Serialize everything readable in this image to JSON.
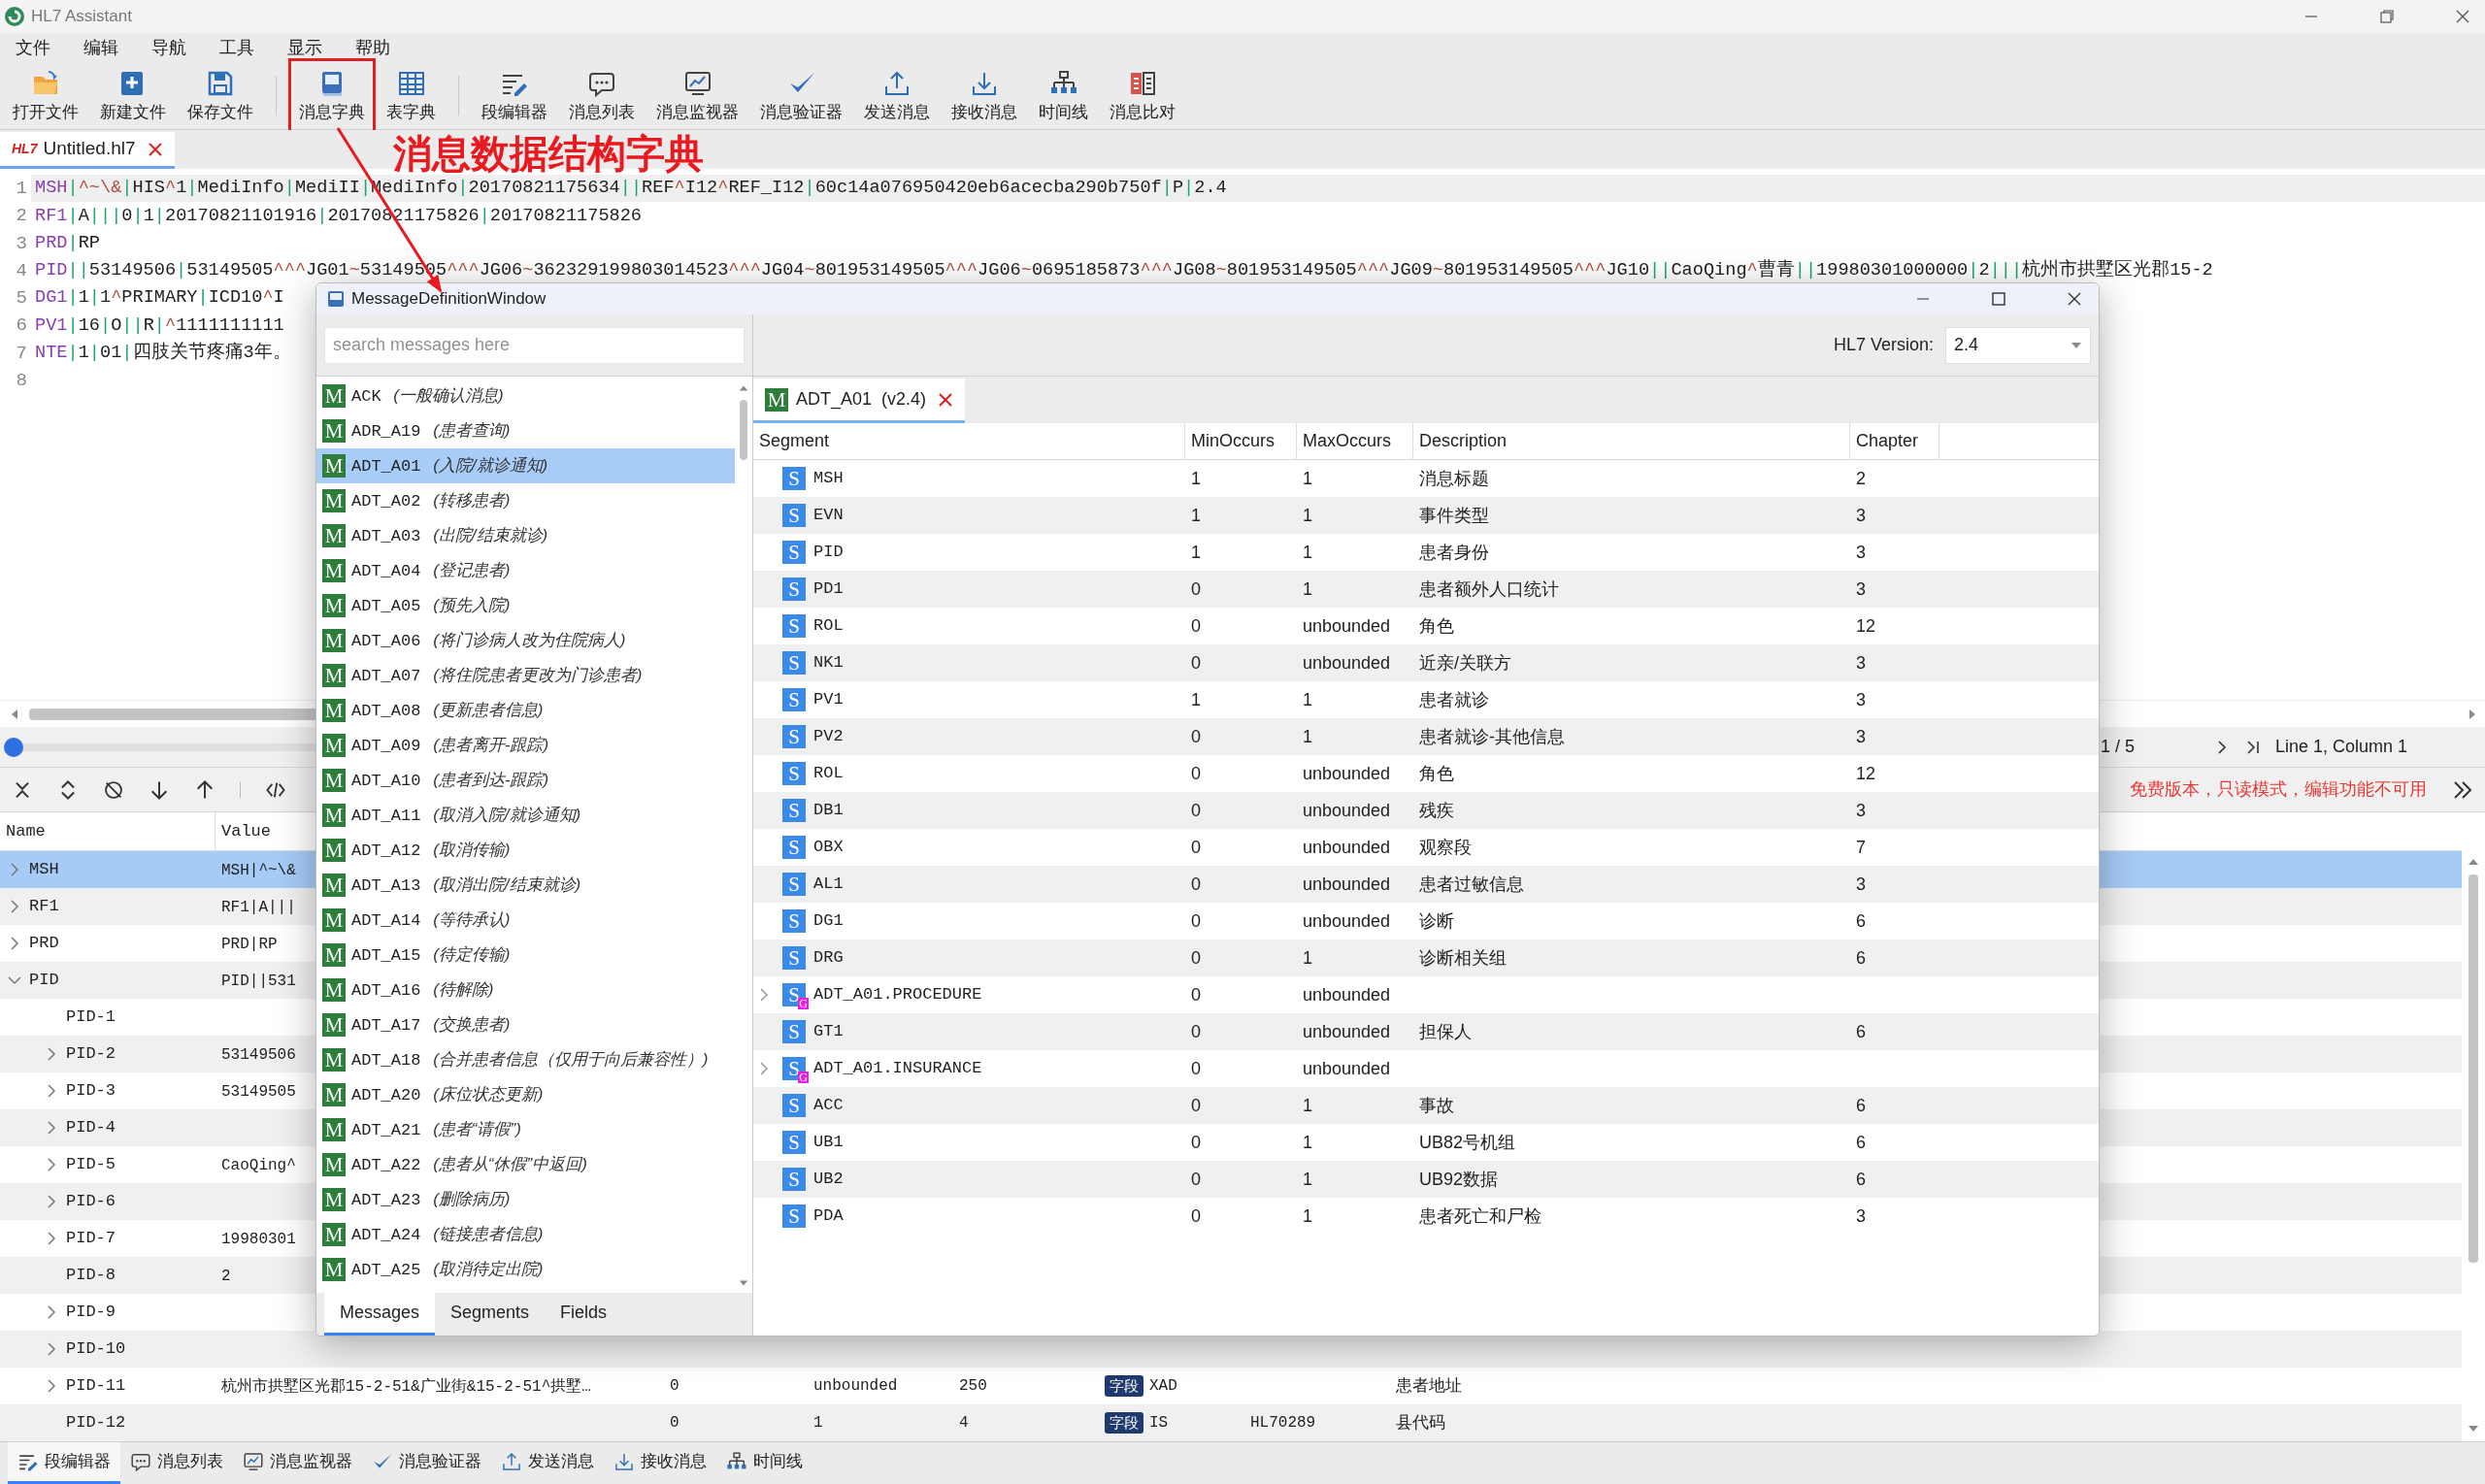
{
  "window": {
    "title": "HL7 Assistant"
  },
  "menu": [
    "文件",
    "编辑",
    "导航",
    "工具",
    "显示",
    "帮助"
  ],
  "toolbar_groups": [
    [
      {
        "label": "打开文件",
        "kind": "open",
        "highlighted": false
      },
      {
        "label": "新建文件",
        "kind": "new",
        "highlighted": false
      },
      {
        "label": "保存文件",
        "kind": "save",
        "highlighted": false
      }
    ],
    [
      {
        "label": "消息字典",
        "kind": "dict",
        "highlighted": true
      },
      {
        "label": "表字典",
        "kind": "table",
        "highlighted": false
      }
    ],
    [
      {
        "label": "段编辑器",
        "kind": "edit",
        "highlighted": false
      },
      {
        "label": "消息列表",
        "kind": "list",
        "highlighted": false
      },
      {
        "label": "消息监视器",
        "kind": "monitor",
        "highlighted": false
      },
      {
        "label": "消息验证器",
        "kind": "validate",
        "highlighted": false
      },
      {
        "label": "发送消息",
        "kind": "send",
        "highlighted": false
      },
      {
        "label": "接收消息",
        "kind": "receive",
        "highlighted": false
      },
      {
        "label": "时间线",
        "kind": "timeline",
        "highlighted": false
      },
      {
        "label": "消息比对",
        "kind": "compare",
        "highlighted": false
      }
    ]
  ],
  "annotation": {
    "text": "消息数据结构字典"
  },
  "file_tab": {
    "badge": "HL7",
    "label": "Untitled.hl7",
    "selected": true
  },
  "editor": {
    "lines": [
      {
        "number": "1",
        "text": "MSH|^~\\&|HIS^1|MediInfo|MediII|MediInfo|20170821175634||REF^I12^REF_I12|60c14a076950420eb6acecba290b750f|P|2.4",
        "current": true
      },
      {
        "number": "2",
        "text": "RF1|A|||0|1|20170821101916|20170821175826|20170821175826",
        "current": false
      },
      {
        "number": "3",
        "text": "PRD|RP",
        "current": false
      },
      {
        "number": "4",
        "text": "PID||53149506|53149505^^^JG01~53149505^^^JG06~362329199803014523^^^JG04~801953149505^^^JG06~0695185873^^^JG08~801953149505^^^JG09~801953149505^^^JG10||CaoQing^曹青||19980301000000|2|||杭州市拱墅区光郡15-2",
        "current": false
      },
      {
        "number": "5",
        "text": "DG1|1|1^PRIMARY|ICD10^I",
        "current": false
      },
      {
        "number": "6",
        "text": "PV1|16|O||R|^1111111111",
        "current": false
      },
      {
        "number": "7",
        "text": "NTE|1|01|四肢关节疼痛3年。",
        "current": false
      },
      {
        "number": "8",
        "current": false
      }
    ]
  },
  "navigator": {
    "slider": {
      "level": 0
    },
    "position": "1 / 5",
    "cursor": "Line 1, Column 1"
  },
  "notice": "免费版本，只读模式，编辑功能不可用",
  "tree": {
    "columns": [
      "Name",
      "Value"
    ],
    "rows": [
      {
        "name": "MSH",
        "value": "MSH|^~\\&",
        "expanded": false,
        "selected": true
      },
      {
        "name": "RF1",
        "value": "RF1|A|||",
        "expanded": false,
        "selected": false
      },
      {
        "name": "PRD",
        "value": "PRD|RP",
        "expanded": false,
        "selected": false
      },
      {
        "name": "PID",
        "value": "PID||531",
        "expanded": true,
        "selected": false,
        "children": [
          {
            "name": "PID-1",
            "selected": false
          },
          {
            "name": "PID-2",
            "value": "53149506",
            "expanded": false,
            "selected": false
          },
          {
            "name": "PID-3",
            "value": "53149505",
            "expanded": false,
            "selected": false
          },
          {
            "name": "PID-4",
            "expanded": false,
            "selected": false
          },
          {
            "name": "PID-5",
            "value": "CaoQing^",
            "expanded": false,
            "selected": false
          },
          {
            "name": "PID-6",
            "expanded": false,
            "selected": false
          },
          {
            "name": "PID-7",
            "value": "19980301",
            "expanded": false,
            "selected": false
          },
          {
            "name": "PID-8",
            "value": "2",
            "selected": false
          },
          {
            "name": "PID-9",
            "expanded": false,
            "selected": false
          },
          {
            "name": "PID-10",
            "expanded": false,
            "selected": false
          },
          {
            "name": "PID-11",
            "value": "杭州市拱墅区光郡15-2-51&广业街&15-2-51^拱墅…",
            "expanded": false,
            "selected": false,
            "cells": {
              "min": "0",
              "max": "unbounded",
              "length": "250",
              "badge": "字段",
              "type": "XAD",
              "description": "患者地址"
            }
          },
          {
            "name": "PID-12",
            "selected": false,
            "cells": {
              "min": "0",
              "max": "1",
              "length": "4",
              "badge": "字段",
              "type": "IS",
              "table": "HL70289",
              "description": "县代码"
            }
          }
        ]
      }
    ]
  },
  "bottom_tabs": [
    {
      "label": "段编辑器",
      "kind": "edit",
      "selected": true
    },
    {
      "label": "消息列表",
      "kind": "list",
      "selected": false
    },
    {
      "label": "消息监视器",
      "kind": "monitor",
      "selected": false
    },
    {
      "label": "消息验证器",
      "kind": "validate",
      "selected": false
    },
    {
      "label": "发送消息",
      "kind": "send",
      "selected": false
    },
    {
      "label": "接收消息",
      "kind": "receive",
      "selected": false
    },
    {
      "label": "时间线",
      "kind": "timeline",
      "selected": false
    }
  ],
  "dialog": {
    "title": "MessageDefinitionWindow",
    "search": {
      "placeholder": "search messages here"
    },
    "messages": [
      {
        "icon": "M",
        "code": "ACK",
        "description": "(一般确认消息)",
        "selected": false
      },
      {
        "icon": "M",
        "code": "ADR_A19",
        "description": "(患者查询)",
        "selected": false
      },
      {
        "icon": "M",
        "code": "ADT_A01",
        "description": "(入院/就诊通知)",
        "selected": true
      },
      {
        "icon": "M",
        "code": "ADT_A02",
        "description": "(转移患者)",
        "selected": false
      },
      {
        "icon": "M",
        "code": "ADT_A03",
        "description": "(出院/结束就诊)",
        "selected": false
      },
      {
        "icon": "M",
        "code": "ADT_A04",
        "description": "(登记患者)",
        "selected": false
      },
      {
        "icon": "M",
        "code": "ADT_A05",
        "description": "(预先入院)",
        "selected": false
      },
      {
        "icon": "M",
        "code": "ADT_A06",
        "description": "(将门诊病人改为住院病人)",
        "selected": false
      },
      {
        "icon": "M",
        "code": "ADT_A07",
        "description": "(将住院患者更改为门诊患者)",
        "selected": false
      },
      {
        "icon": "M",
        "code": "ADT_A08",
        "description": "(更新患者信息)",
        "selected": false
      },
      {
        "icon": "M",
        "code": "ADT_A09",
        "description": "(患者离开-跟踪)",
        "selected": false
      },
      {
        "icon": "M",
        "code": "ADT_A10",
        "description": "(患者到达-跟踪)",
        "selected": false
      },
      {
        "icon": "M",
        "code": "ADT_A11",
        "description": "(取消入院/就诊通知)",
        "selected": false
      },
      {
        "icon": "M",
        "code": "ADT_A12",
        "description": "(取消传输)",
        "selected": false
      },
      {
        "icon": "M",
        "code": "ADT_A13",
        "description": "(取消出院/结束就诊)",
        "selected": false
      },
      {
        "icon": "M",
        "code": "ADT_A14",
        "description": "(等待承认)",
        "selected": false
      },
      {
        "icon": "M",
        "code": "ADT_A15",
        "description": "(待定传输)",
        "selected": false
      },
      {
        "icon": "M",
        "code": "ADT_A16",
        "description": "(待解除)",
        "selected": false
      },
      {
        "icon": "M",
        "code": "ADT_A17",
        "description": "(交换患者)",
        "selected": false
      },
      {
        "icon": "M",
        "code": "ADT_A18",
        "description": "(合并患者信息（仅用于向后兼容性）)",
        "selected": false
      },
      {
        "icon": "M",
        "code": "ADT_A20",
        "description": "(床位状态更新)",
        "selected": false
      },
      {
        "icon": "M",
        "code": "ADT_A21",
        "description": "(患者“请假”)",
        "selected": false
      },
      {
        "icon": "M",
        "code": "ADT_A22",
        "description": "(患者从“休假”中返回)",
        "selected": false
      },
      {
        "icon": "M",
        "code": "ADT_A23",
        "description": "(删除病历)",
        "selected": false
      },
      {
        "icon": "M",
        "code": "ADT_A24",
        "description": "(链接患者信息)",
        "selected": false
      },
      {
        "icon": "M",
        "code": "ADT_A25",
        "description": "(取消待定出院)",
        "selected": false
      }
    ],
    "pane_tabs": [
      {
        "label": "Messages",
        "selected": true
      },
      {
        "label": "Segments",
        "selected": false
      },
      {
        "label": "Fields",
        "selected": false
      }
    ],
    "version_label": "HL7 Version:",
    "version": "2.4",
    "doc_tab": {
      "icon": "M",
      "label": "ADT_A01  (v2.4)",
      "selected": true
    },
    "columns": [
      "Segment",
      "MinOccurs",
      "MaxOccurs",
      "Description",
      "Chapter"
    ],
    "rows": [
      {
        "kind": "segment",
        "icon": "S",
        "segment": "MSH",
        "min": "1",
        "max": "1",
        "description": "消息标题",
        "chapter": "2"
      },
      {
        "kind": "segment",
        "icon": "S",
        "segment": "EVN",
        "min": "1",
        "max": "1",
        "description": "事件类型",
        "chapter": "3"
      },
      {
        "kind": "segment",
        "icon": "S",
        "segment": "PID",
        "min": "1",
        "max": "1",
        "description": "患者身份",
        "chapter": "3"
      },
      {
        "kind": "segment",
        "icon": "S",
        "segment": "PD1",
        "min": "0",
        "max": "1",
        "description": "患者额外人口统计",
        "chapter": "3"
      },
      {
        "kind": "segment",
        "icon": "S",
        "segment": "ROL",
        "min": "0",
        "max": "unbounded",
        "description": "角色",
        "chapter": "12"
      },
      {
        "kind": "segment",
        "icon": "S",
        "segment": "NK1",
        "min": "0",
        "max": "unbounded",
        "description": "近亲/关联方",
        "chapter": "3"
      },
      {
        "kind": "segment",
        "icon": "S",
        "segment": "PV1",
        "min": "1",
        "max": "1",
        "description": "患者就诊",
        "chapter": "3"
      },
      {
        "kind": "segment",
        "icon": "S",
        "segment": "PV2",
        "min": "0",
        "max": "1",
        "description": "患者就诊-其他信息",
        "chapter": "3"
      },
      {
        "kind": "segment",
        "icon": "S",
        "segment": "ROL",
        "min": "0",
        "max": "unbounded",
        "description": "角色",
        "chapter": "12"
      },
      {
        "kind": "segment",
        "icon": "S",
        "segment": "DB1",
        "min": "0",
        "max": "unbounded",
        "description": "残疾",
        "chapter": "3"
      },
      {
        "kind": "segment",
        "icon": "S",
        "segment": "OBX",
        "min": "0",
        "max": "unbounded",
        "description": "观察段",
        "chapter": "7"
      },
      {
        "kind": "segment",
        "icon": "S",
        "segment": "AL1",
        "min": "0",
        "max": "unbounded",
        "description": "患者过敏信息",
        "chapter": "3"
      },
      {
        "kind": "segment",
        "icon": "S",
        "segment": "DG1",
        "min": "0",
        "max": "unbounded",
        "description": "诊断",
        "chapter": "6"
      },
      {
        "kind": "segment",
        "icon": "S",
        "segment": "DRG",
        "min": "0",
        "max": "1",
        "description": "诊断相关组",
        "chapter": "6"
      },
      {
        "kind": "group",
        "icon": "S",
        "sub_icon": "G",
        "segment": "ADT_A01.PROCEDURE",
        "min": "0",
        "max": "unbounded",
        "expanded": false
      },
      {
        "kind": "segment",
        "icon": "S",
        "segment": "GT1",
        "min": "0",
        "max": "unbounded",
        "description": "担保人",
        "chapter": "6"
      },
      {
        "kind": "group",
        "icon": "S",
        "sub_icon": "G",
        "segment": "ADT_A01.INSURANCE",
        "min": "0",
        "max": "unbounded",
        "expanded": false
      },
      {
        "kind": "segment",
        "icon": "S",
        "segment": "ACC",
        "min": "0",
        "max": "1",
        "description": "事故",
        "chapter": "6"
      },
      {
        "kind": "segment",
        "icon": "S",
        "segment": "UB1",
        "min": "0",
        "max": "1",
        "description": "UB82号机组",
        "chapter": "6"
      },
      {
        "kind": "segment",
        "icon": "S",
        "segment": "UB2",
        "min": "0",
        "max": "1",
        "description": "UB92数据",
        "chapter": "6"
      },
      {
        "kind": "segment",
        "icon": "S",
        "segment": "PDA",
        "min": "0",
        "max": "1",
        "description": "患者死亡和尸检",
        "chapter": "3"
      }
    ]
  }
}
